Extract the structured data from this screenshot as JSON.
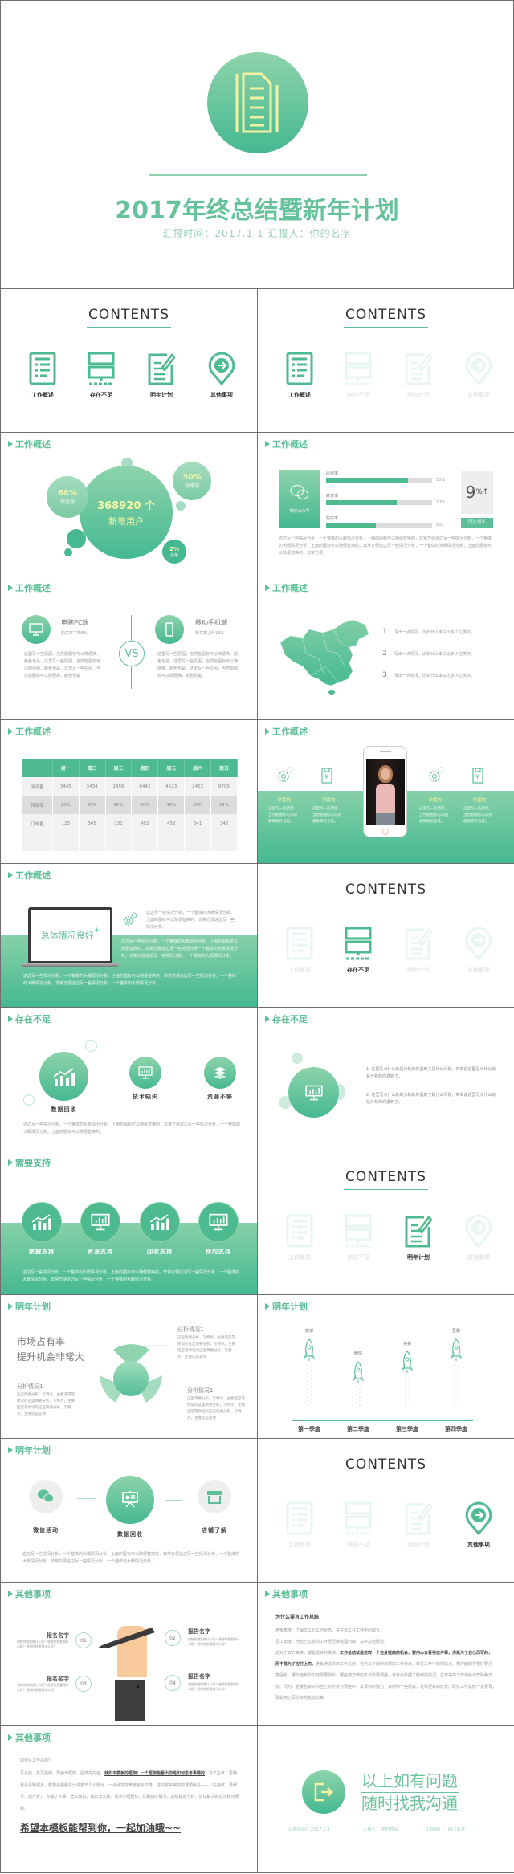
{
  "cover": {
    "title": "2017年终总结暨新年计划",
    "subtitle": "汇报时间：2017.1.1  汇报人：你的名字"
  },
  "contents": {
    "title": "CONTENTS",
    "items": [
      "工作概述",
      "存在不足",
      "明年计划",
      "其他事项"
    ]
  },
  "sections": {
    "overview": "工作概述",
    "shortcomings": "存在不足",
    "support": "需要支持",
    "plan": "明年计划",
    "other": "其他事项"
  },
  "colors": {
    "accent": "#5dbf97",
    "accent_dark": "#45b991",
    "accent_light": "#8ed3ab",
    "icon_yellow": "#f4f1a0"
  },
  "bubbles": {
    "main_value": "368920 个",
    "main_label": "新增用户",
    "b1_value": "68%",
    "b1_label": "微信端",
    "b2_value": "30%",
    "b2_label": "微博端",
    "b3_value": "2%",
    "b3_label": "头条"
  },
  "bars": {
    "box_label": "微信公众号",
    "items": [
      {
        "label": "阅读率",
        "value": "15%",
        "fill": 0.77
      },
      {
        "label": "转发率",
        "value": "10%",
        "fill": 0.67
      },
      {
        "label": "购买率",
        "value": "5%",
        "fill": 0.47
      }
    ],
    "big_value": "9",
    "big_unit": "%↑",
    "button": "同比增长",
    "paragraph": "这边写一些情况分析，一个整体的大概情况分析，上面的图标可以随便替换的，非常方便这边写一些情况分析，一个整体的大概情况分析，上面的图标可以随便替换的，非常方便这边写一些情况分析，一个整体的大概情况分析，上面的图标可以随便替换的，非常方便。"
  },
  "vs": {
    "label": "VS",
    "pc_title": "电脑PC端",
    "pc_sub": "购买率下降8%",
    "mobile_title": "移动手机端",
    "mobile_sub": "购买率上升18%",
    "pc_text": "这里写一些原因，当然能图标可以随便换，颜色也是。这里写一些原因，当然能图标可以随便换，颜色也是。这里写一些原因，当然能图标可以随便换，颜色也是",
    "mobile_text": "这里写一些原因，当然能图标可以随便换，颜色也是。这里写一些原因，当然能图标可以随便换，颜色也是。这里写一些原因，当然能图标可以随便换，颜色也是。"
  },
  "map": {
    "items": [
      {
        "num": "1",
        "text": "写出一点情况，比如什么率占比多少之类的。"
      },
      {
        "num": "2",
        "text": "写出一点情况，比如什么率占比多少之类的。"
      },
      {
        "num": "3",
        "text": "写出一点情况，比如什么率占比多少之类的。"
      }
    ]
  },
  "table": {
    "headers": [
      "",
      "周一",
      "周二",
      "周三",
      "周四",
      "周五",
      "周六",
      "周日"
    ],
    "rows": [
      [
        "阅读量",
        "3445",
        "3434",
        "2456",
        "6442",
        "4523",
        "2452",
        "6785"
      ],
      [
        "转发率",
        "20%",
        "30%",
        "45%",
        "30%",
        "46%",
        "39%",
        "24%"
      ],
      [
        "订单量",
        "123",
        "345",
        "231",
        "452",
        "452",
        "341",
        "342"
      ]
    ]
  },
  "phone": {
    "items": [
      {
        "label": "设置的",
        "text": "这里写一些原因，当然能图标可以随便换颜色也是。"
      },
      {
        "label": "设置的",
        "text": "这里写一些原因，当然能图标可以随便换颜色也是。"
      },
      {
        "label": "设置的",
        "text": "这里写一些原因，当然能图标可以随便换颜色也是。"
      },
      {
        "label": "设置的",
        "text": "这里写一些原因，当然能图标可以随便换颜色也是。"
      }
    ]
  },
  "laptop": {
    "screen_text": "总体情况良好",
    "p1": "这边写一些情况分析，一个整体的大概情况分析。上面的图标可以随便替换的，非常方便这边写一些情况分析。",
    "p2": "这边写一些情况分析，一个整体的大概情况分析。上面的图标可以随便替换的，非常方便这边写一些情况分析一个整体的大概情况分析。非常方便这边写一些情况分析，一个整体的大概情况分析。",
    "p3": "这边写一些情况分析，一个整体的大概情况分析。上面的图标可以随便替换的，非常方便这边写一些情况分析，一个整体的大概情况分析。非常方便这边写一些情况分析，一个整体的大概情况分析。"
  },
  "short1": {
    "items": [
      "数据回收",
      "技术缺失",
      "资源不够"
    ],
    "paragraph": "这边写一些情况分析，一个整体的大概情况分析。上面的图标可以随便替换的，非常方便这边写一些情况分析，一个整体的大概情况分析。上面的图标可以随便替换的。"
  },
  "short2": {
    "points": [
      "1. 这里写点什么就是分析的你遇到了是什么问题，简单说这里写点什么就是分析的你遇到了。",
      "2. 这里写点什么就是分析的你遇到了是什么问题，简单说这里写点什么就是分析的你遇到了。"
    ]
  },
  "support": {
    "items": [
      "数据支持",
      "资源支持",
      "回收支持",
      "你的支持"
    ],
    "paragraph": "这边写一些情况分析，一个整体的大概情况分析。上面的图标可以随便替换的，非常方便这边写一些情况分析，一个整体的大概情况分析。非常方便这边写一些情况分析，一个整体的大概情况分析。"
  },
  "plan1": {
    "headline1": "市场占有率",
    "headline2": "提升机会非常大",
    "a_title": "分析情况1",
    "a_text": "这里简要分析，写特点，主要还是靠你说的这里简要分析，写特点，主要还是靠你说的这里简要分析，写特点，主要还是靠你",
    "b_title": "分析情况1",
    "b_text": "这里简要分析，写特点，主要还是靠你说的这里简要分析，写特点，主要还是靠你说的这里简要分析，写特点，主要还是靠你",
    "c_title": "分析情况1",
    "c_text": "这里简要分析，写特点，主要还是靠你说的这里简要分析，写特点，主要还是靠你说的这里简要分析，写特点，主要还是靠你"
  },
  "plan2": {
    "rockets": [
      "微博",
      "微信",
      "头条",
      "豆瓣"
    ],
    "quarters": [
      "第一季度",
      "第二季度",
      "第三季度",
      "第四季度"
    ]
  },
  "plan3": {
    "items": [
      "微信活动",
      "数据回收",
      "店铺了解"
    ],
    "paragraph": "这边写一些情况分析，一个整体的大概情况分析。上面的图标可以随便替换的，非常方便这边写一些情况分析，一个整体的大概情况分析。非常方便这边写一些情况分析，一个整体的大概情况分析。"
  },
  "other1": {
    "items": [
      {
        "num": "01",
        "name": "报名名字"
      },
      {
        "num": "02",
        "name": "报告名字"
      },
      {
        "num": "03",
        "name": "报名名字"
      },
      {
        "num": "04",
        "name": "报告名字"
      }
    ],
    "desc": "想想你想要做什么呢？想想你想要做什么呢？想想你想要做什么呢？"
  },
  "other2": {
    "title": "为什么要写工作总结",
    "line1": "老板角度：了解员工的工作状态，关注员工在工作中的成长。",
    "line2": "员工角度：为自己过去的工作经历做梳理归纳，从中总结经验。",
    "p_start": "这对于双方来讲，都是很好的事情。",
    "p_bold": "工作总结就是这样一个自身提高的机会，要用心去看待这件事，你是为了自己而写的，而不是为了应付上司。",
    "p_rest": "老板通过你的工作总结，也可以了解你目前的工作状态，和在工作中的优缺点，哪方面做得很好要注意强化，哪方面有所欠缺需要弥补，哪些地方做的不对需要调整，老板会依据了解到的情况，在未来的工作中给与帮助和支持。同时，老板也会从你自己的分析与调整中，发现你的潜力，会给你一些机会，让你更好的成长。既然工作总结一定要写，那就用心写份好的总结出来。"
  },
  "other3": {
    "question": "如何写工作总结？",
    "p_start": "写总结，先写提纲，再画出框架，后填充内容。",
    "p_bold": "就如本模板的框架！一个框架能看出你是如何思考事情的",
    "p_rest": "，有了主体，思路就会清晰很多，框架会把整体分成若干个小部分，一点点填充难度也会下降。这时候采用的叙述顺序是——『先整体、再细节、后分析』，你做了件事，怎么做的，做的怎么样。简单介绍整体，详细描述细节，总结输出分析，尝试解决的办法和时间线。",
    "closing": "希望本模板能帮到你，一起加油哦~~"
  },
  "ending": {
    "line1": "以上如有问题",
    "line2": "随时找我沟通",
    "meta1": "汇报时间：2017.1.1",
    "meta2": "汇报人：你的姓名",
    "meta3": "汇报部门：部门名称"
  }
}
